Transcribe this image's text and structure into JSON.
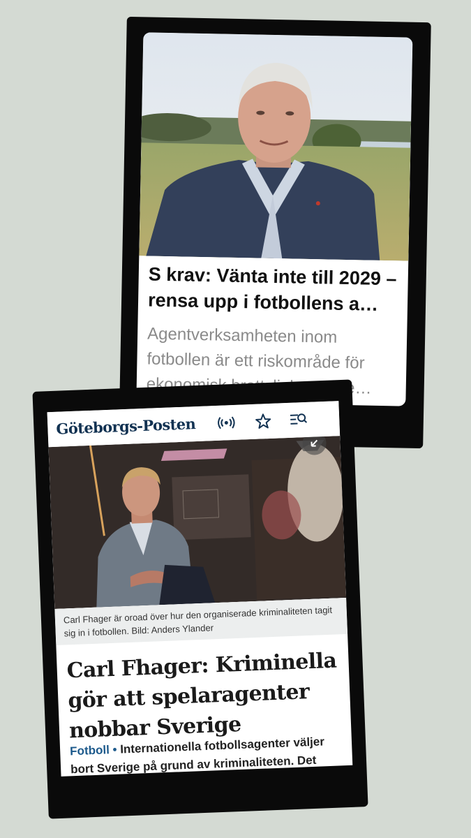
{
  "article_top": {
    "headline": "S krav: Vänta inte till 2029 – rensa upp i fotbollens a…",
    "lead": "Agentverksamheten inom fotbollen är ett riskområde för ekonomisk brottslighet – me…"
  },
  "article_bottom": {
    "logo": "Göteborgs-Posten",
    "icons": [
      "live-broadcast-icon",
      "star-icon",
      "menu-search-icon",
      "collapse-arrow-icon"
    ],
    "caption": "Carl Fhager är oroad över hur den organiserade kriminaliteten tagit sig in i fotbollen. Bild: Anders Ylander",
    "headline": "Carl Fhager: Kriminella gör att spelaragenter nobbar Sverige",
    "section": "Fotboll",
    "bullet": "•",
    "lead": "Internationella fotbollsagenter väljer bort Sverige på grund av kriminaliteten. Det"
  },
  "colors": {
    "background": "#d4dad3",
    "frame": "#0a0a0a",
    "gp_navy": "#123252",
    "section_blue": "#1d5a8c"
  }
}
